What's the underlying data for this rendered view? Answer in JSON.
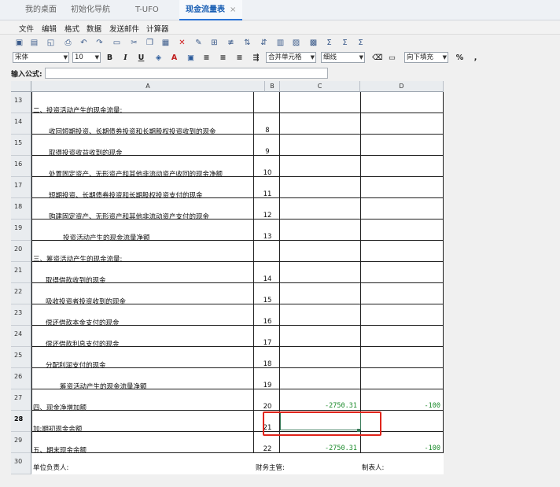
{
  "tabs": [
    {
      "label": "我的桌面",
      "active": false
    },
    {
      "label": "初始化导航",
      "active": false
    },
    {
      "label": "T-UFO",
      "active": false
    },
    {
      "label": "现金流量表",
      "active": true
    }
  ],
  "tab_close_glyph": "×",
  "menu": [
    "文件",
    "编辑",
    "格式",
    "数据",
    "发送邮件",
    "计算器"
  ],
  "toolbar": {
    "icons": [
      "save-icon",
      "save-all-icon",
      "print-preview-icon",
      "print-icon",
      "undo-icon",
      "redo-icon",
      "cut-icon",
      "copy-icon",
      "paste-icon",
      "delete-icon",
      "format-painter-icon",
      "insert-icon",
      "rename-icon",
      "sort-asc-icon",
      "sort-desc-icon",
      "filter-icon",
      "calculate-icon",
      "sum-icon",
      "sum-row-icon",
      "sum-col-icon"
    ]
  },
  "format_bar": {
    "font": "宋体",
    "size": "10",
    "bold": "B",
    "italic": "I",
    "underline": "U",
    "merge": "合并单元格",
    "border": "细线",
    "fill": "向下填充",
    "percent": "%",
    "comma": ","
  },
  "formula": {
    "label": "输入公式:",
    "value": ""
  },
  "columns": [
    "A",
    "B",
    "C",
    "D"
  ],
  "rows": [
    {
      "num": "13",
      "a": "二、投资活动产生的现金流量:",
      "b": "",
      "c": "",
      "d": ""
    },
    {
      "num": "14",
      "a": "收回短期投资、长期债券投资和长期股权投资收到的现金",
      "b": "8",
      "c": "",
      "d": ""
    },
    {
      "num": "15",
      "a": "取得投资收益收到的现金",
      "b": "9",
      "c": "",
      "d": ""
    },
    {
      "num": "16",
      "a": "处置固定资产、无形资产和其他非流动资产收回的现金净额",
      "b": "10",
      "c": "",
      "d": ""
    },
    {
      "num": "17",
      "a": "短期投资、长期债券投资和长期股权投资支付的现金",
      "b": "11",
      "c": "",
      "d": ""
    },
    {
      "num": "18",
      "a": "购建固定资产、无形资产和其他非流动资产支付的现金",
      "b": "12",
      "c": "",
      "d": ""
    },
    {
      "num": "19",
      "a": "投资活动产生的现金流量净额",
      "b": "13",
      "c": "",
      "d": ""
    },
    {
      "num": "20",
      "a": "三、筹资活动产生的现金流量:",
      "b": "",
      "c": "",
      "d": ""
    },
    {
      "num": "21",
      "a": "取得借款收到的现金",
      "b": "14",
      "c": "",
      "d": ""
    },
    {
      "num": "22",
      "a": "吸收投资者投资收到的现金",
      "b": "15",
      "c": "",
      "d": ""
    },
    {
      "num": "23",
      "a": "偿还借款本金支付的现金",
      "b": "16",
      "c": "",
      "d": ""
    },
    {
      "num": "24",
      "a": "偿还借款利息支付的现金",
      "b": "17",
      "c": "",
      "d": ""
    },
    {
      "num": "25",
      "a": "分配利润支付的现金",
      "b": "18",
      "c": "",
      "d": ""
    },
    {
      "num": "26",
      "a": "筹资活动产生的现金流量净额",
      "b": "19",
      "c": "",
      "d": ""
    },
    {
      "num": "27",
      "a": "四、现金净增加额",
      "b": "20",
      "c": "-2750.31",
      "d": "-100"
    },
    {
      "num": "28",
      "a": "加:期初现金余额",
      "b": "21",
      "c": "",
      "d": ""
    },
    {
      "num": "29",
      "a": "五、期末现金余额",
      "b": "22",
      "c": "-2750.31",
      "d": "-100"
    },
    {
      "num": "30",
      "a": "单位负责人:",
      "b": "财务主管:",
      "c": "",
      "d": "制表人:"
    }
  ],
  "colors": {
    "accent": "#2b73d6",
    "positive_text": "#1a8a2a",
    "highlight": "#e0241b"
  }
}
